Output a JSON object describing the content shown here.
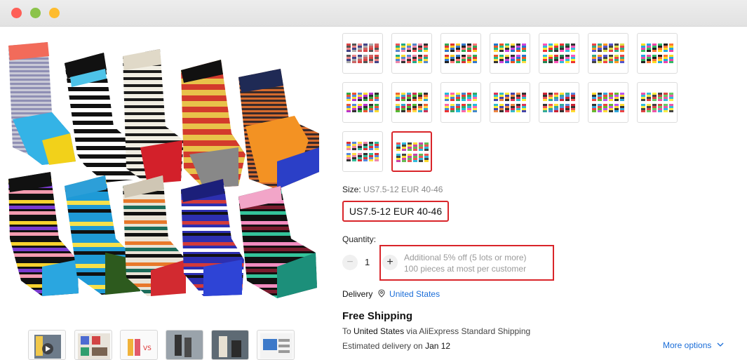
{
  "window": {
    "controls": [
      "close",
      "minimize",
      "zoom"
    ]
  },
  "variants": {
    "count": 16,
    "selected_index": 15
  },
  "size": {
    "label": "Size:",
    "value": "US7.5-12 EUR 40-46",
    "option": "US7.5-12 EUR 40-46"
  },
  "quantity": {
    "label": "Quantity:",
    "value": "1",
    "minus": "−",
    "plus": "+",
    "promo_line1": "Additional 5% off (5 lots or more)",
    "promo_line2": "100 pieces at most per customer"
  },
  "delivery": {
    "label": "Delivery",
    "location": "United States",
    "pin_icon": "location-pin-icon"
  },
  "shipping": {
    "title": "Free Shipping",
    "to_prefix": "To",
    "to_country": "United States",
    "via_text": "via AliExpress Standard Shipping",
    "estimated_prefix": "Estimated delivery on",
    "estimated_date": "Jan 12",
    "more_options": "More options"
  },
  "colors": {
    "accent_red": "#d9252a",
    "link_blue": "#1a6dd8"
  }
}
